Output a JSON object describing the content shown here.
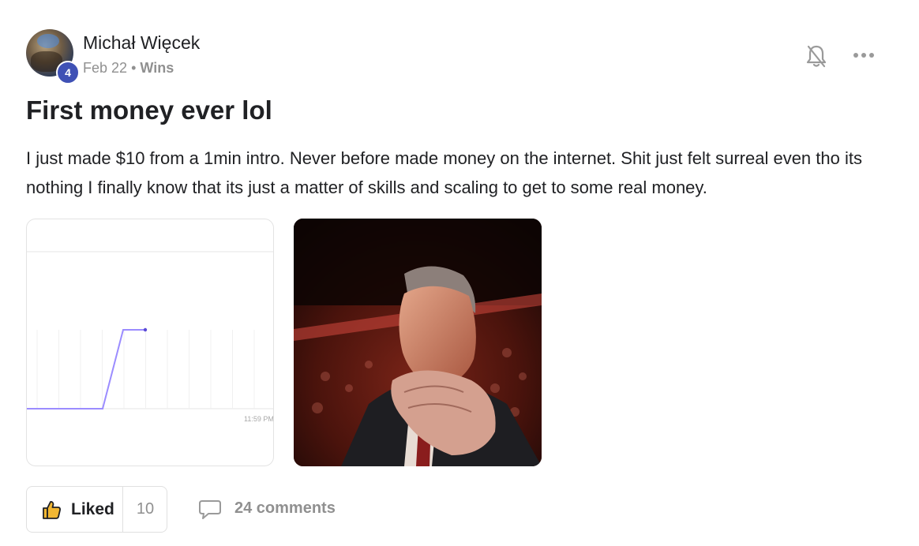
{
  "post": {
    "author": {
      "name": "Michał Więcek",
      "level": "4"
    },
    "date": "Feb 22",
    "separator": "•",
    "category": "Wins",
    "title": "First money ever lol",
    "body": "I just made $10 from a 1min intro. Never before made money on the internet. Shit just felt surreal even tho its nothing I finally know that its just a matter of skills and scaling to get to some real money.",
    "attachments": [
      {
        "kind": "chart-screenshot",
        "chart_data": {
          "type": "line",
          "x_tick_label": "11:59 PM",
          "values": [
            0,
            0,
            0,
            0,
            0,
            1,
            1
          ],
          "line_color": "#9b8cff"
        }
      },
      {
        "kind": "gif-photo"
      }
    ],
    "actions": {
      "like_label": "Liked",
      "like_count": "10",
      "comments_label": "24 comments"
    }
  },
  "icons": {
    "bell": "bell-off-icon",
    "more": "more-horizontal-icon",
    "like": "thumbs-up-icon",
    "comment": "comment-bubble-icon"
  },
  "colors": {
    "badge": "#3f51b5",
    "muted_text": "#909090",
    "like_icon_fill": "#f2b733"
  }
}
